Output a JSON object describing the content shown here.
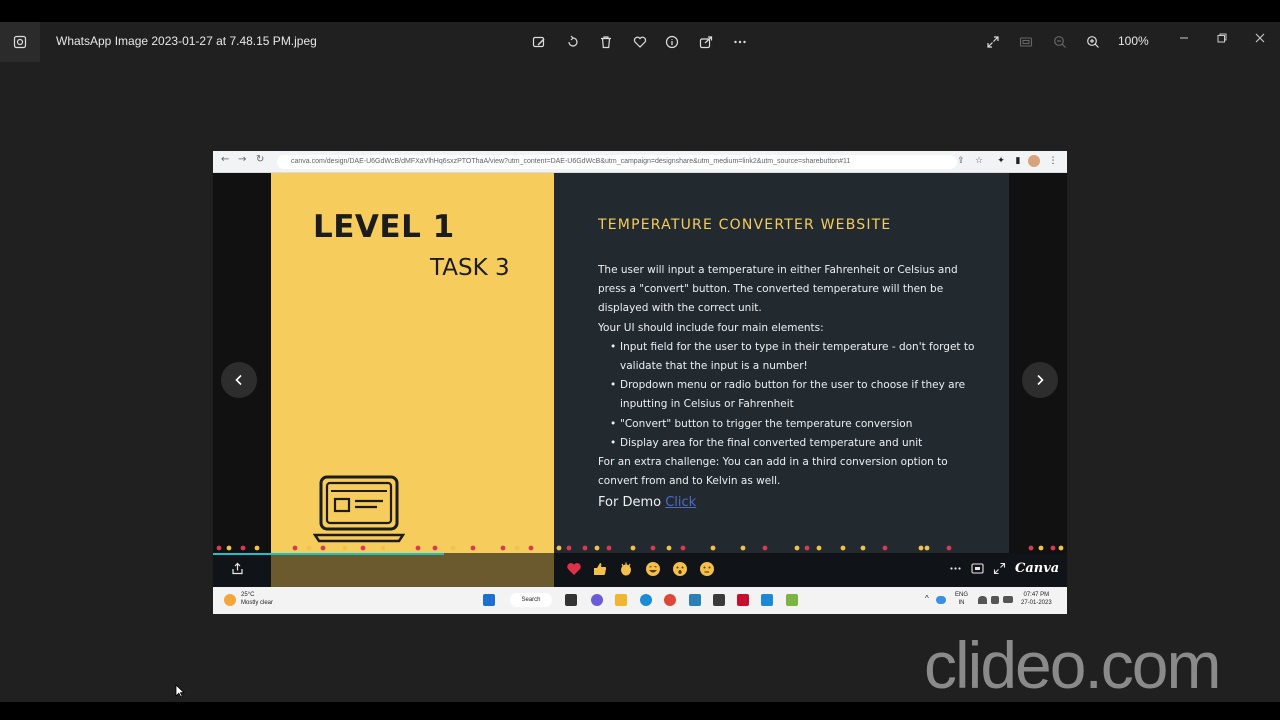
{
  "window": {
    "title": "WhatsApp Image 2023-01-27 at 7.48.15 PM.jpeg",
    "zoom": "100%",
    "toolbar_icons": [
      "edit-icon",
      "rotate-icon",
      "delete-icon",
      "favorite-icon",
      "info-icon",
      "share-icon",
      "more-icon"
    ],
    "right_icons": [
      "fullscreen-icon",
      "fit-icon",
      "zoom-out-icon",
      "zoom-in-icon"
    ]
  },
  "browser": {
    "url": "canva.com/design/DAE-U6GdWcB/dMFXaVlhHq6sxzPTOThaA/view?utm_content=DAE-U6GdWcB&utm_campaign=designshare&utm_medium=link2&utm_source=sharebutton#11"
  },
  "slide": {
    "level": "LEVEL 1",
    "task": "TASK 3",
    "title": "TEMPERATURE CONVERTER WEBSITE",
    "intro": "The user will input a temperature in either Fahrenheit or Celsius and press a \"convert\" button. The converted temperature will then be displayed with the correct unit.",
    "ui_heading": "Your UI should include four main elements:",
    "bullets": [
      "Input field for the user to type in their temperature - don't forget to validate that the input is a number!",
      "Dropdown menu or radio button for the user to choose if they are inputting in Celsius or Fahrenheit",
      "\"Convert\" button to trigger the temperature conversion",
      "Display area for the final converted temperature and unit"
    ],
    "challenge": "For an extra challenge: You can add in a third conversion option to convert from and to Kelvin as well.",
    "demo_label": "For Demo",
    "demo_link": "Click",
    "progress": 0.27
  },
  "presenter": {
    "brand": "Canva"
  },
  "taskbar": {
    "temperature": "25°C",
    "weather": "Mostly clear",
    "search": "Search",
    "lang_top": "ENG",
    "lang_bottom": "IN",
    "time": "07:47 PM",
    "date": "27-01-2023"
  },
  "watermark": "clideo.com",
  "colors": {
    "slide_yellow": "#f6cd5c",
    "slide_dark": "#222a30",
    "link_blue": "#4a6cc8",
    "progress_teal": "#18c3c8"
  }
}
